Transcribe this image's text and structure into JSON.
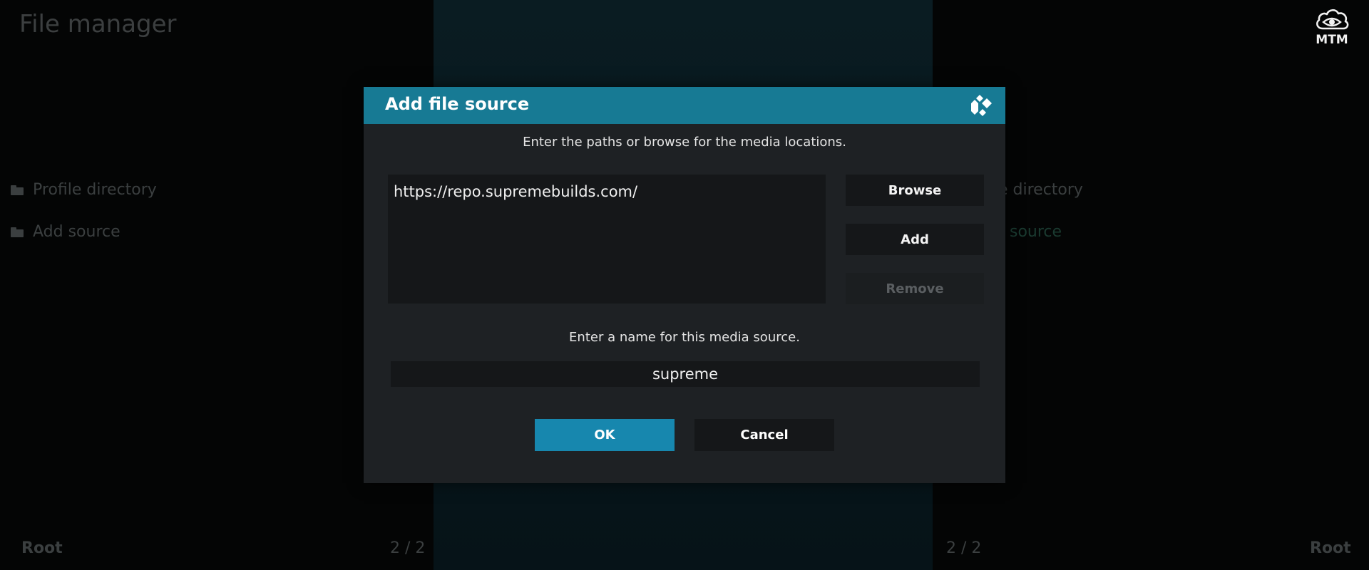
{
  "background": {
    "app_title": "File manager",
    "logo_text": "MTM",
    "left_pane": {
      "items": [
        {
          "label": "Profile directory",
          "icon": "folder-icon"
        },
        {
          "label": "Add source",
          "icon": "folder-icon"
        }
      ],
      "footer_label": "Root",
      "footer_count": "2 / 2"
    },
    "right_pane": {
      "items": [
        {
          "label": "e directory"
        },
        {
          "label": "source"
        }
      ],
      "footer_label": "Root",
      "footer_count": "2 / 2"
    }
  },
  "dialog": {
    "title": "Add file source",
    "header_icon": "kodi-logo-icon",
    "paths_instruction": "Enter the paths or browse for the media locations.",
    "paths": [
      "https://repo.supremebuilds.com/"
    ],
    "buttons": {
      "browse": "Browse",
      "add": "Add",
      "remove": "Remove"
    },
    "name_instruction": "Enter a name for this media source.",
    "name_value": "supreme",
    "ok": "OK",
    "cancel": "Cancel"
  },
  "colors": {
    "accent": "#177a94",
    "ok_button": "#1787ae",
    "dialog_bg": "#1e2124"
  }
}
